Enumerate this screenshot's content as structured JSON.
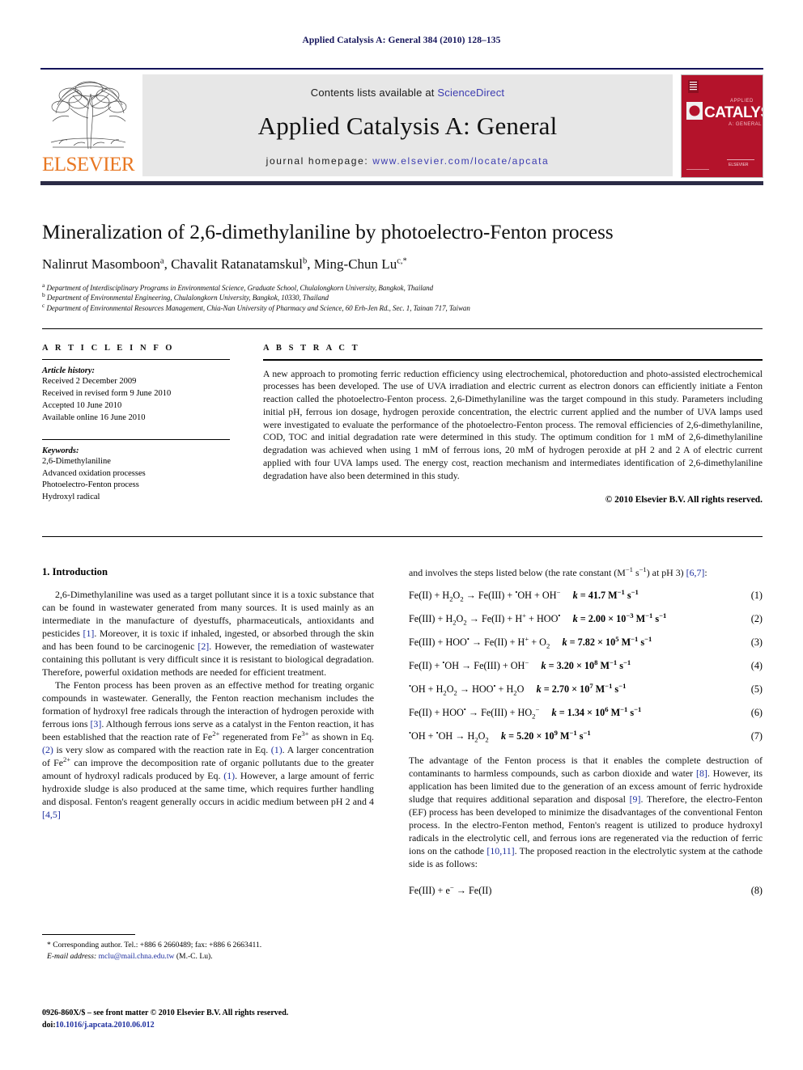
{
  "running_head": "Applied Catalysis A: General 384 (2010) 128–135",
  "masthead": {
    "contents_prefix": "Contents lists available at ",
    "sciencedirect": "ScienceDirect",
    "journal_title": "Applied Catalysis A: General",
    "homepage_prefix": "journal homepage:",
    "homepage_url": "www.elsevier.com/locate/apcata",
    "publisher_wordmark": "ELSEVIER",
    "cover_title": "CATALYSIS",
    "cover_super": "APPLIED",
    "cover_sub": "A: GENERAL",
    "accent_red": "#b4132b",
    "accent_orange": "#e87722",
    "link_blue": "#3b3bb0",
    "rule_navy": "#14145a"
  },
  "title": "Mineralization of 2,6-dimethylaniline by photoelectro-Fenton process",
  "authors": [
    {
      "name": "Nalinrut Masomboon",
      "marks": "a"
    },
    {
      "name": "Chavalit Ratanatamskul",
      "marks": "b"
    },
    {
      "name": "Ming-Chun Lu",
      "marks": "c,*"
    }
  ],
  "affiliations": [
    {
      "mark": "a",
      "text": "Department of Interdisciplinary Programs in Environmental Science, Graduate School, Chulalongkorn University, Bangkok, Thailand"
    },
    {
      "mark": "b",
      "text": "Department of Environmental Engineering, Chulalongkorn University, Bangkok, 10330, Thailand"
    },
    {
      "mark": "c",
      "text": "Department of Environmental Resources Management, Chia-Nan University of Pharmacy and Science, 60 Erh-Jen Rd., Sec. 1, Tainan 717, Taiwan"
    }
  ],
  "article_info": {
    "heading": "A R T I C L E   I N F O",
    "history_label": "Article history:",
    "history": [
      "Received 2 December 2009",
      "Received in revised form 9 June 2010",
      "Accepted 10 June 2010",
      "Available online 16 June 2010"
    ],
    "keywords_label": "Keywords:",
    "keywords": [
      "2,6-Dimethylaniline",
      "Advanced oxidation processes",
      "Photoelectro-Fenton process",
      "Hydroxyl radical"
    ]
  },
  "abstract": {
    "heading": "A B S T R A C T",
    "text": "A new approach to promoting ferric reduction efficiency using electrochemical, photoreduction and photo-assisted electrochemical processes has been developed. The use of UVA irradiation and electric current as electron donors can efficiently initiate a Fenton reaction called the photoelectro-Fenton process. 2,6-Dimethylaniline was the target compound in this study. Parameters including initial pH, ferrous ion dosage, hydrogen peroxide concentration, the electric current applied and the number of UVA lamps used were investigated to evaluate the performance of the photoelectro-Fenton process. The removal efficiencies of 2,6-dimethylaniline, COD, TOC and initial degradation rate were determined in this study. The optimum condition for 1 mM of 2,6-dimethylaniline degradation was achieved when using 1 mM of ferrous ions, 20 mM of hydrogen peroxide at pH 2 and 2 A of electric current applied with four UVA lamps used. The energy cost, reaction mechanism and intermediates identification of 2,6-dimethylaniline degradation have also been determined in this study.",
    "copyright": "© 2010 Elsevier B.V. All rights reserved."
  },
  "introduction": {
    "heading": "1. Introduction",
    "paragraph_1_parts": {
      "a": "2,6-Dimethylaniline was used as a target pollutant since it is a toxic substance that can be found in wastewater generated from many sources. It is used mainly as an intermediate in the manufacture of dyestuffs, pharmaceuticals, antioxidants and pesticides ",
      "ref1": "[1]",
      "b": ". Moreover, it is toxic if inhaled, ingested, or absorbed through the skin and has been found to be carcinogenic ",
      "ref2": "[2]",
      "c": ". However, the remediation of wastewater containing this pollutant is very difficult since it is resistant to biological degradation. Therefore, powerful oxidation methods are needed for efficient treatment."
    },
    "paragraph_2_parts": {
      "a": "The Fenton process has been proven as an effective method for treating organic compounds in wastewater. Generally, the Fenton reaction mechanism includes the formation of hydroxyl free radicals through the interaction of hydrogen peroxide with ferrous ions ",
      "ref3": "[3]",
      "b": ". Although ferrous ions serve as a catalyst in the Fenton reaction, it has been established that the reaction rate of Fe",
      "sup1": "2+",
      "c": " regenerated from Fe",
      "sup2": "3+",
      "d": " as shown in Eq. ",
      "eqref2": "(2)",
      "e": " is very slow as compared with the reaction rate in Eq. ",
      "eqref1": "(1)",
      "f": ". A larger concentration of Fe",
      "sup3": "2+",
      "g": " can improve the decomposition rate of organic pollutants due to the greater amount of hydroxyl radicals produced by Eq. ",
      "eqref1b": "(1)",
      "h": ". However, a large amount of ferric hydroxide sludge is also produced at the same time, which requires further handling and disposal. Fenton's reagent generally occurs in acidic medium between pH 2 and 4 ",
      "ref45": "[4,5]"
    },
    "right_lead_parts": {
      "a": "and involves the steps listed below (the rate constant (M",
      "sup_m": "−1",
      "b": " s",
      "sup_s": "−1",
      "c": ") at pH 3) ",
      "ref67": "[6,7]",
      "d": ":"
    },
    "paragraph_3_parts": {
      "a": "The advantage of the Fenton process is that it enables the complete destruction of contaminants to harmless compounds, such as carbon dioxide and water ",
      "ref8": "[8]",
      "b": ". However, its application has been limited due to the generation of an excess amount of ferric hydroxide sludge that requires additional separation and disposal ",
      "ref9": "[9]",
      "c": ". Therefore, the electro-Fenton (EF) process has been developed to minimize the disadvantages of the conventional Fenton process. In the electro-Fenton method, Fenton's reagent is utilized to produce hydroxyl radicals in the electrolytic cell, and ferrous ions are regenerated via the reduction of ferric ions on the cathode ",
      "ref1011": "[10,11]",
      "d": ". The proposed reaction in the electrolytic system at the cathode side is as follows:"
    }
  },
  "equations": [
    {
      "number": "(1)",
      "lhs": "Fe(II) + H<sub class=\"s\">2</sub>O<sub class=\"s\">2</sub> → Fe(III) + <sup class=\"s\">•</sup>OH + OH<sup class=\"s\">−</sup>",
      "k": "k",
      "kvalue": "= 41.7 M<sup class=\"s\">−1</sup> s<sup class=\"s\">−1</sup>"
    },
    {
      "number": "(2)",
      "lhs": "Fe(III) + H<sub class=\"s\">2</sub>O<sub class=\"s\">2</sub> → Fe(II) + H<sup class=\"s\">+</sup> + HOO<sup class=\"s\">•</sup>",
      "k": "k",
      "kvalue": "= 2.00 × 10<sup class=\"s\">−3</sup> M<sup class=\"s\">−1</sup> s<sup class=\"s\">−1</sup>"
    },
    {
      "number": "(3)",
      "lhs": "Fe(III) + HOO<sup class=\"s\">•</sup> → Fe(II) + H<sup class=\"s\">+</sup> + O<sub class=\"s\">2</sub>",
      "k": "k",
      "kvalue": "= 7.82 × 10<sup class=\"s\">5</sup> M<sup class=\"s\">−1</sup> s<sup class=\"s\">−1</sup>"
    },
    {
      "number": "(4)",
      "lhs": "Fe(II) + <sup class=\"s\">•</sup>OH → Fe(III) + OH<sup class=\"s\">−</sup>",
      "k": "k",
      "kvalue": "= 3.20 × 10<sup class=\"s\">8</sup> M<sup class=\"s\">−1</sup> s<sup class=\"s\">−1</sup>"
    },
    {
      "number": "(5)",
      "lhs": "<sup class=\"s\">•</sup>OH + H<sub class=\"s\">2</sub>O<sub class=\"s\">2</sub> → HOO<sup class=\"s\">•</sup> + H<sub class=\"s\">2</sub>O",
      "k": "k",
      "kvalue": "= 2.70 × 10<sup class=\"s\">7</sup> M<sup class=\"s\">−1</sup> s<sup class=\"s\">−1</sup>"
    },
    {
      "number": "(6)",
      "lhs": "Fe(II) + HOO<sup class=\"s\">•</sup> → Fe(III) + HO<sub class=\"s\">2</sub><sup class=\"s\">−</sup>",
      "k": "k",
      "kvalue": "= 1.34 × 10<sup class=\"s\">6</sup> M<sup class=\"s\">−1</sup> s<sup class=\"s\">−1</sup>"
    },
    {
      "number": "(7)",
      "lhs": "<sup class=\"s\">•</sup>OH + <sup class=\"s\">•</sup>OH → H<sub class=\"s\">2</sub>O<sub class=\"s\">2</sub>",
      "k": "k",
      "kvalue": "= 5.20 × 10<sup class=\"s\">9</sup> M<sup class=\"s\">−1</sup> s<sup class=\"s\">−1</sup>"
    }
  ],
  "equation_8": {
    "number": "(8)",
    "lhs": "Fe(III) + e<sup class=\"s\">−</sup> → Fe(II)"
  },
  "footnote": {
    "corresponding": "* Corresponding author. Tel.: +886 6 2660489; fax: +886 6 2663411.",
    "email_label": "E-mail address:",
    "email": "mclu@mail.chna.edu.tw",
    "email_owner": "(M.-C. Lu)."
  },
  "imprint": {
    "line1": "0926-860X/$ – see front matter © 2010 Elsevier B.V. All rights reserved.",
    "doi_label": "doi:",
    "doi_value": "10.1016/j.apcata.2010.06.012"
  }
}
